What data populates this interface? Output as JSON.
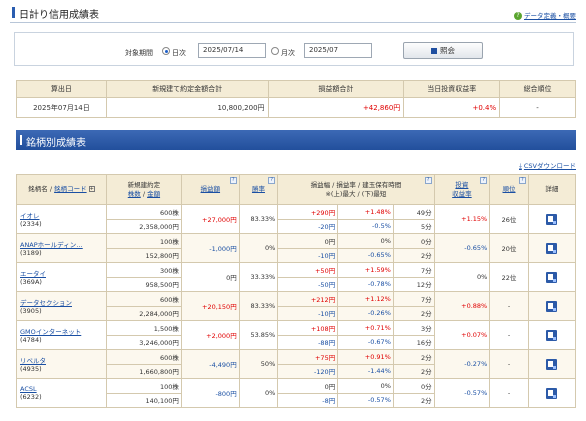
{
  "page": {
    "title": "日計り信用成績表",
    "help_label": "データ定義・概要"
  },
  "search": {
    "label": "対象期間",
    "daily_label": "日次",
    "daily_value": "2025/07/14",
    "monthly_label": "月次",
    "monthly_value": "2025/07",
    "button_label": "照会"
  },
  "summary": {
    "headers": [
      "算出日",
      "新規建て約定金額合計",
      "損益額合計",
      "当日投資収益率",
      "総合順位"
    ],
    "values": [
      "2025年07月14日",
      "10,800,200円",
      "+42,860円",
      "+0.4%",
      "-"
    ]
  },
  "section": {
    "title": "銘柄別成績表",
    "csv_label": "CSVダウンロード"
  },
  "table": {
    "headers": {
      "name": "銘柄名",
      "code": "銘柄コード",
      "new_amount_1": "新規建約定",
      "new_amount_2": "株数",
      "new_amount_3": "金額",
      "pl": "損益額",
      "win_rate": "勝率",
      "range_1": "損益幅 / 損益率 / 建玉保有時間",
      "range_2": "※(上)最大 / (下)最短",
      "roi_1": "投資",
      "roi_2": "収益率",
      "rank": "順位",
      "detail": "詳細",
      "q": "?"
    },
    "rows": [
      {
        "name": "イオレ",
        "code": "(2334)",
        "shares": "600株",
        "amount": "2,358,000円",
        "pl": "+27,000円",
        "win": "83.33%",
        "max_pl": "+290円",
        "max_rate": "+1.48%",
        "max_time": "49分",
        "min_pl": "-20円",
        "min_rate": "-0.5%",
        "min_time": "5分",
        "roi": "+1.15%",
        "rank": "26位"
      },
      {
        "name": "ANAPホールディン…",
        "code": "(3189)",
        "shares": "100株",
        "amount": "152,800円",
        "pl": "-1,000円",
        "win": "0%",
        "max_pl": "0円",
        "max_rate": "0%",
        "max_time": "0分",
        "min_pl": "-10円",
        "min_rate": "-0.65%",
        "min_time": "2分",
        "roi": "-0.65%",
        "rank": "20位"
      },
      {
        "name": "エータイ",
        "code": "(369A)",
        "shares": "300株",
        "amount": "958,500円",
        "pl": "0円",
        "win": "33.33%",
        "max_pl": "+50円",
        "max_rate": "+1.59%",
        "max_time": "7分",
        "min_pl": "-50円",
        "min_rate": "-0.78%",
        "min_time": "12分",
        "roi": "0%",
        "rank": "22位"
      },
      {
        "name": "データセクション",
        "code": "(3905)",
        "shares": "600株",
        "amount": "2,284,000円",
        "pl": "+20,150円",
        "win": "83.33%",
        "max_pl": "+212円",
        "max_rate": "+1.12%",
        "max_time": "7分",
        "min_pl": "-10円",
        "min_rate": "-0.26%",
        "min_time": "2分",
        "roi": "+0.88%",
        "rank": "-"
      },
      {
        "name": "GMOインターネット",
        "code": "(4784)",
        "shares": "1,500株",
        "amount": "3,246,000円",
        "pl": "+2,000円",
        "win": "53.85%",
        "max_pl": "+108円",
        "max_rate": "+0.71%",
        "max_time": "3分",
        "min_pl": "-88円",
        "min_rate": "-0.67%",
        "min_time": "16分",
        "roi": "+0.07%",
        "rank": "-"
      },
      {
        "name": "リベルタ",
        "code": "(4935)",
        "shares": "600株",
        "amount": "1,660,800円",
        "pl": "-4,490円",
        "win": "50%",
        "max_pl": "+75円",
        "max_rate": "+0.91%",
        "max_time": "2分",
        "min_pl": "-120円",
        "min_rate": "-1.44%",
        "min_time": "2分",
        "roi": "-0.27%",
        "rank": "-"
      },
      {
        "name": "ACSL",
        "code": "(6232)",
        "shares": "100株",
        "amount": "140,100円",
        "pl": "-800円",
        "win": "0%",
        "max_pl": "0円",
        "max_rate": "0%",
        "max_time": "0分",
        "min_pl": "-8円",
        "min_rate": "-0.57%",
        "min_time": "2分",
        "roi": "-0.57%",
        "rank": "-"
      }
    ]
  }
}
